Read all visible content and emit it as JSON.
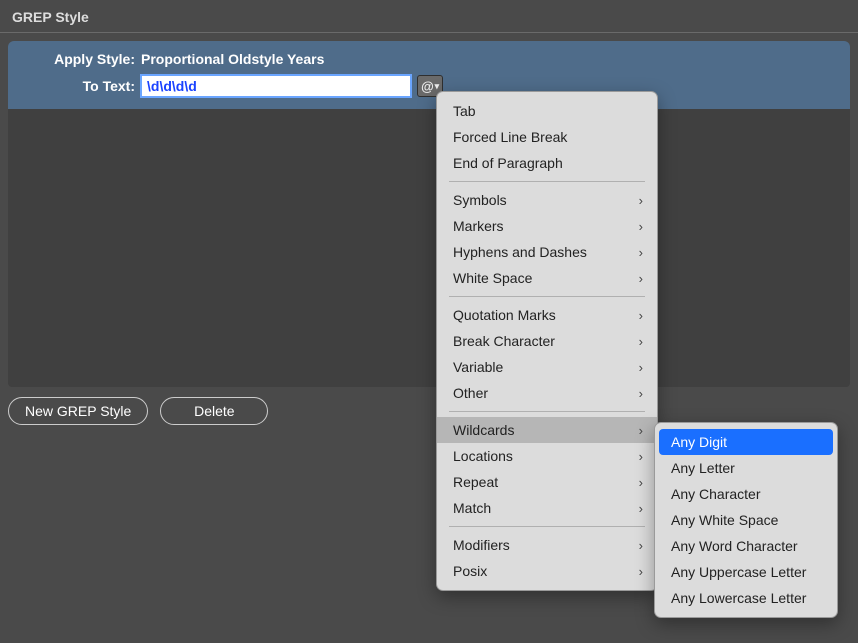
{
  "header": {
    "title": "GREP Style"
  },
  "panel": {
    "apply_style_label": "Apply Style:",
    "apply_style_value": "Proportional Oldstyle Years",
    "to_text_label": "To Text:",
    "to_text_value": "\\d\\d\\d\\d",
    "at_button": "@"
  },
  "buttons": {
    "new_grep": "New GREP Style",
    "delete": "Delete"
  },
  "menu": {
    "tab": "Tab",
    "forced_line_break": "Forced Line Break",
    "end_of_paragraph": "End of Paragraph",
    "symbols": "Symbols",
    "markers": "Markers",
    "hyphens_dashes": "Hyphens and Dashes",
    "white_space": "White Space",
    "quotation_marks": "Quotation Marks",
    "break_character": "Break Character",
    "variable": "Variable",
    "other": "Other",
    "wildcards": "Wildcards",
    "locations": "Locations",
    "repeat": "Repeat",
    "match": "Match",
    "modifiers": "Modifiers",
    "posix": "Posix"
  },
  "submenu": {
    "any_digit": "Any Digit",
    "any_letter": "Any Letter",
    "any_character": "Any Character",
    "any_white_space": "Any White Space",
    "any_word_character": "Any Word Character",
    "any_uppercase": "Any Uppercase Letter",
    "any_lowercase": "Any Lowercase Letter"
  }
}
